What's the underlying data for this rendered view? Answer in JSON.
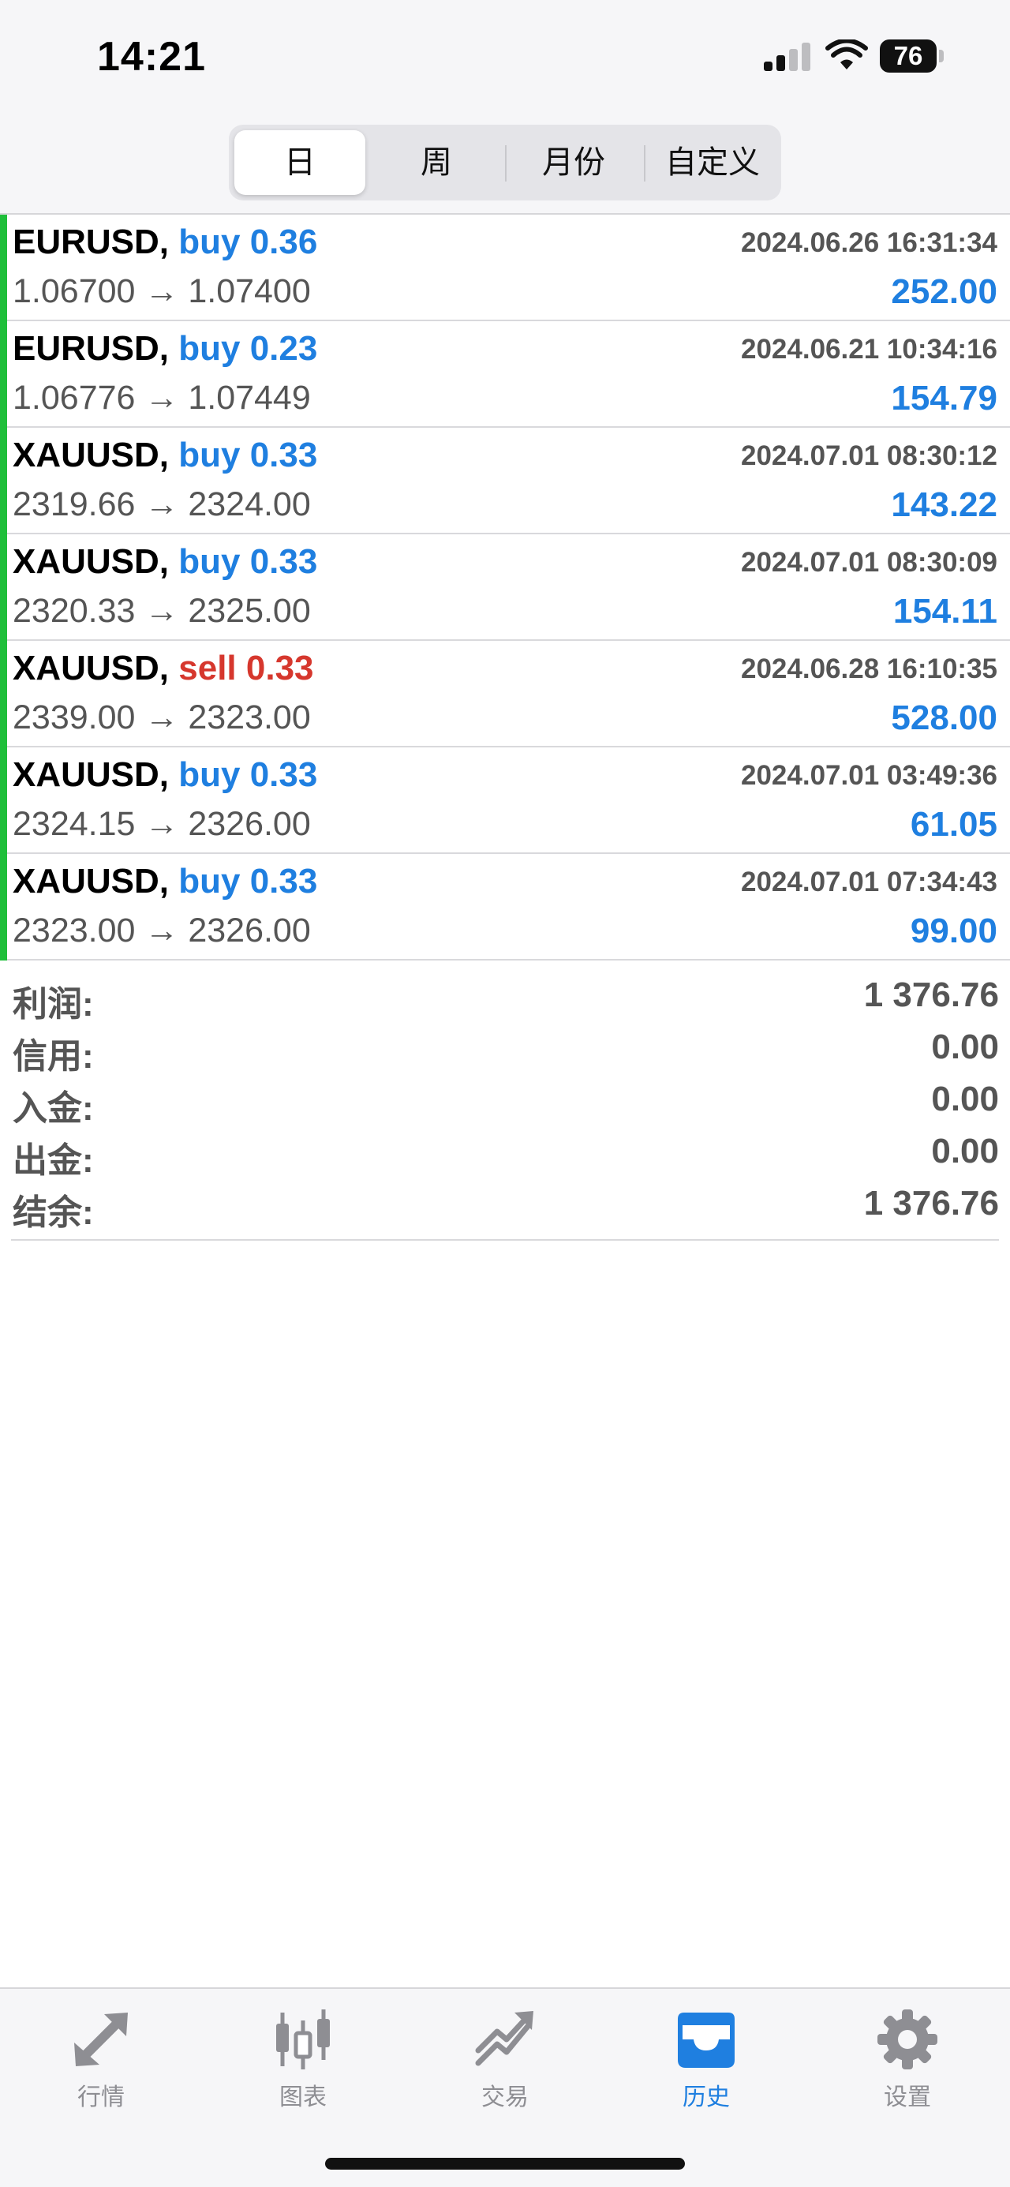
{
  "status_bar": {
    "time": "14:21",
    "battery": "76"
  },
  "period_tabs": [
    {
      "label": "日",
      "active": true
    },
    {
      "label": "周",
      "active": false
    },
    {
      "label": "月份",
      "active": false
    },
    {
      "label": "自定义",
      "active": false
    }
  ],
  "trades": [
    {
      "symbol": "EURUSD,",
      "direction": "buy 0.36",
      "time": "2024.06.26 16:31:34",
      "prices": "1.06700 → 1.07400",
      "profit": "252.00"
    },
    {
      "symbol": "EURUSD,",
      "direction": "buy 0.23",
      "time": "2024.06.21 10:34:16",
      "prices": "1.06776 → 1.07449",
      "profit": "154.79"
    },
    {
      "symbol": "XAUUSD,",
      "direction": "buy 0.33",
      "time": "2024.07.01 08:30:12",
      "prices": "2319.66 → 2324.00",
      "profit": "143.22"
    },
    {
      "symbol": "XAUUSD,",
      "direction": "buy 0.33",
      "time": "2024.07.01 08:30:09",
      "prices": "2320.33 → 2325.00",
      "profit": "154.11"
    },
    {
      "symbol": "XAUUSD,",
      "direction": "sell 0.33",
      "time": "2024.06.28 16:10:35",
      "prices": "2339.00 → 2323.00",
      "profit": "528.00"
    },
    {
      "symbol": "XAUUSD,",
      "direction": "buy 0.33",
      "time": "2024.07.01 03:49:36",
      "prices": "2324.15 → 2326.00",
      "profit": "61.05"
    },
    {
      "symbol": "XAUUSD,",
      "direction": "buy 0.33",
      "time": "2024.07.01 07:34:43",
      "prices": "2323.00 → 2326.00",
      "profit": "99.00"
    }
  ],
  "summary": [
    {
      "label": "利润:",
      "value": "1 376.76"
    },
    {
      "label": "信用:",
      "value": "0.00"
    },
    {
      "label": "入金:",
      "value": "0.00"
    },
    {
      "label": "出金:",
      "value": "0.00"
    },
    {
      "label": "结余:",
      "value": "1 376.76"
    }
  ],
  "tabbar": [
    {
      "label": "行情",
      "icon": "quotes-arrows-icon",
      "active": false
    },
    {
      "label": "图表",
      "icon": "candlestick-chart-icon",
      "active": false
    },
    {
      "label": "交易",
      "icon": "trade-trend-icon",
      "active": false
    },
    {
      "label": "历史",
      "icon": "history-inbox-icon",
      "active": true
    },
    {
      "label": "设置",
      "icon": "gear-icon",
      "active": false
    }
  ],
  "colors": {
    "accent_blue": "#1f7fe0",
    "sell_red": "#d6372d",
    "buy_bar_green": "#1fbf3a",
    "muted_text": "#555555",
    "inactive_icon": "#8e8e93"
  }
}
